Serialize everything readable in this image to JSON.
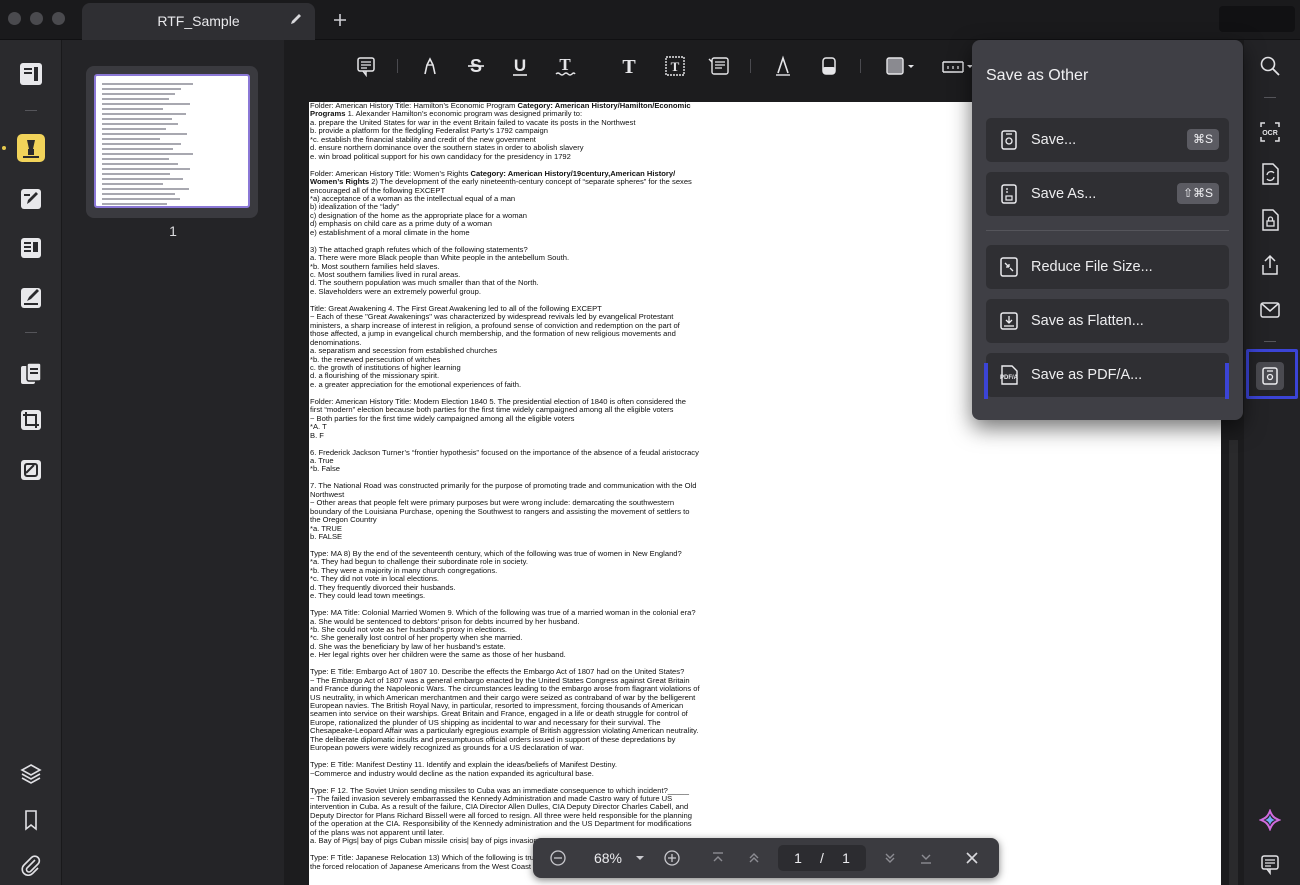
{
  "window": {
    "tab_title": "RTF_Sample",
    "new_tab_label": "+"
  },
  "thumbnails": {
    "page_numbers": [
      "1"
    ]
  },
  "save_menu": {
    "title": "Save as Other",
    "items": [
      {
        "label": "Save...",
        "shortcut": "⌘S",
        "icon": "save-icon"
      },
      {
        "label": "Save As...",
        "shortcut": "⇧⌘S",
        "icon": "save-as-icon"
      },
      {
        "label": "Reduce File Size...",
        "shortcut": "",
        "icon": "compress-icon"
      },
      {
        "label": "Save as Flatten...",
        "shortcut": "",
        "icon": "flatten-icon"
      },
      {
        "label": "Save as PDF/A...",
        "shortcut": "",
        "icon": "pdfa-icon"
      }
    ]
  },
  "bottom_bar": {
    "zoom": "68%",
    "current_page": "1",
    "separator": "/",
    "total_pages": "1"
  },
  "document": {
    "paragraphs": [
      [
        "Folder: American History Title: Hamilton’s Economic Program ",
        "**Category: American History/Hamilton/Economic Programs** 1. Alexander Hamilton’s economic program was designed primarily to:",
        "a. prepare the United States for war in the event Britain failed to vacate its posts in the Northwest",
        "b. provide a platform for the fledgling Federalist Party’s 1792 campaign",
        "*c. establish the financial stability and credit of the new government",
        "d. ensure northern dominance over the southern states in order to abolish slavery",
        "e. win broad political support for his own candidacy for the presidency in 1792"
      ],
      [
        "Folder: American History Title: Women’s Rights ",
        "**Category: American History/19century,American History/ Women’s Rights** 2) The development of the early nineteenth-century concept of “separate spheres” for the sexes encouraged all of the following EXCEPT",
        "*a) acceptance of a woman as the intellectual equal of a man",
        "b) idealization of the “lady”",
        "c) designation of the home as the appropriate place for a woman",
        "d) emphasis on child care as a prime duty of a woman",
        "e) establishment of a moral climate in the home"
      ],
      [
        "3) The attached graph refutes which of the following statements?",
        "a. There were more Black people than White people in the antebellum South.",
        "*b. Most southern families held slaves.",
        "c. Most southern families lived in rural areas.",
        "d. The southern population was much smaller than that of the North.",
        "e. Slaveholders were an extremely powerful group."
      ],
      [
        "Title: Great Awakening 4. The First Great Awakening led to all of the following EXCEPT",
        "~ Each of these \"Great Awakenings\" was characterized by widespread revivals led by evangelical Protestant ministers, a sharp increase of interest in religion, a profound sense of conviction and redemption on the part of those affected, a jump in evangelical church membership, and the formation of new religious movements and denominations.",
        "a. separatism and secession from established churches",
        "*b. the renewed persecution of witches",
        "c. the growth of institutions of higher learning",
        "d. a flourishing of the missionary spirit.",
        "e. a greater appreciation for the emotional experiences of faith."
      ],
      [
        "Folder: American History Title: Modern Election 1840 5. The presidential election of 1840 is often considered the first “modern” election because both parties for the first time widely campaigned among all the eligible voters",
        "~ Both parties for the first time widely campaigned among all the eligible voters",
        "*A. T",
        "B. F"
      ],
      [
        "6. Frederick Jackson Turner’s “frontier hypothesis” focused on the importance of the absence of a feudal aristocracy",
        "a. True",
        "*b. False"
      ],
      [
        "7. The National Road was constructed primarily for the purpose of promoting trade and communication with the Old Northwest",
        "~ Other areas that people felt were primary purposes but were wrong include: demarcating the southwestern boundary of the Louisiana Purchase, opening the Southwest to rangers and assisting the movement of settlers to the Oregon Country",
        "*a. TRUE",
        "b. FALSE"
      ],
      [
        "Type: MA 8) By the end of the seventeenth century, which of the following was true of women in New England?",
        "*a. They had begun to challenge their subordinate role in society.",
        "*b. They were a majority in many church congregations.",
        "*c. They did not vote in local elections.",
        "d. They frequently divorced their husbands.",
        "e. They could lead town meetings."
      ],
      [
        "Type: MA Title: Colonial Married Women 9. Which of the following was true of a married woman in the colonial era?",
        "a. She would be sentenced to debtors’ prison for debts incurred by her husband.",
        "*b. She could not vote as her husband’s proxy in elections.",
        "*c. She generally lost control of her property when she married.",
        "d. She was the beneficiary by law of her husband’s estate.",
        "e. Her legal rights over her children were the same as those of her husband."
      ],
      [
        "Type: E Title: Embargo Act of 1807 10. Describe the effects the Embargo Act of 1807 had on the United States?",
        "~ The Embargo Act of 1807 was a general embargo enacted by the United States Congress against Great Britain and France during the Napoleonic Wars. The circumstances leading to the embargo arose from flagrant violations of US neutrality, in which American merchantmen and their cargo were seized as contraband of war by the belligerent European navies. The British Royal Navy, in particular, resorted to impressment, forcing thousands of American seamen into service on their warships. Great Britain and France, engaged in a life or death struggle for control of Europe, rationalized the plunder of US shipping as incidental to war and necessary for their survival. The Chesapeake-Leopard Affair was a particularly egregious example of British aggression violating American neutrality. The deliberate diplomatic insults and presumptuous official orders issued in support of these depredations by European powers were widely recognized as grounds for a US declaration of war."
      ],
      [
        " Type: E Title: Manifest Destiny 11. Identify and explain the ideas/beliefs of Manifest Destiny.",
        "~Commerce and industry would decline as the nation expanded its agricultural base."
      ],
      [
        "Type: F 12. The Soviet Union sending missiles to Cuba was an immediate consequence to which incident?_____",
        "~ The failed invasion severely embarrassed the Kennedy Administration and made Castro wary of future US intervention in Cuba. As a result of the failure, CIA Director Allen Dulles, CIA Deputy Director Charles Cabell, and Deputy Director for Plans Richard Bissell were all forced to resign. All three were held responsible for the planning of the operation at the CIA. Responsibility of the Kennedy administration and the US Department for modifications of the plans was not apparent until later.",
        "a. Bay of Pigs| bay of pigs Cuban missile crisis| bay of pigs invasion"
      ],
      [
        "Type: F Title: Japanese Relocation 13) Which of the following is true about the Japanese relocation? _____ justified the forced relocation of Japanese Americans from the West Coast during the Second World War?_____"
      ]
    ]
  }
}
